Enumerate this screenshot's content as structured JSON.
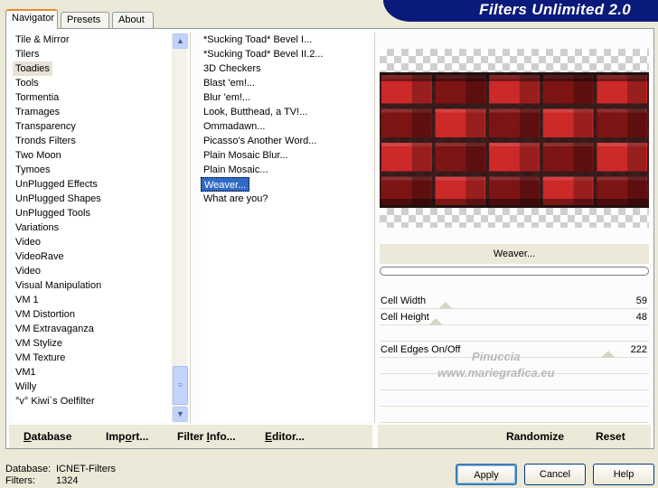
{
  "banner": {
    "title": "Filters Unlimited 2.0"
  },
  "tabs": [
    {
      "label": "Navigator",
      "active": true
    },
    {
      "label": "Presets",
      "active": false
    },
    {
      "label": "About",
      "active": false
    }
  ],
  "categories": [
    "Tile & Mirror",
    "Tilers",
    "Toadies",
    "Tools",
    "Tormentia",
    "Tramages",
    "Transparency",
    "Tronds Filters",
    "Two Moon",
    "Tymoes",
    "UnPlugged Effects",
    "UnPlugged Shapes",
    "UnPlugged Tools",
    "Variations",
    "Video",
    "VideoRave",
    "Video",
    "Visual Manipulation",
    "VM 1",
    "VM Distortion",
    "VM Extravaganza",
    "VM Stylize",
    "VM Texture",
    "VM1",
    "Willy",
    "°v° Kiwi`s Oelfilter"
  ],
  "selected_category": "Toadies",
  "filters": [
    "*Sucking Toad*  Bevel I...",
    "*Sucking Toad*  Bevel II.2...",
    "3D Checkers",
    "Blast 'em!...",
    "Blur 'em!...",
    "Look, Butthead, a TV!...",
    "Ommadawn...",
    "Picasso's Another Word...",
    "Plain Mosaic Blur...",
    "Plain Mosaic...",
    "Weaver...",
    "What are you?"
  ],
  "selected_filter": "Weaver...",
  "filter_name": "Weaver...",
  "progress": 0,
  "parameters": [
    {
      "label": "Cell Width",
      "value": "59",
      "level": 0.23
    },
    {
      "label": "Cell Height",
      "value": "48",
      "level": 0.19
    },
    {
      "label": "Cell Edges On/Off",
      "value": "222",
      "level": 0.87
    }
  ],
  "watermark": {
    "line1": "Pinuccia",
    "line2": "www.mariegrafica.eu"
  },
  "actions": {
    "database": {
      "u": "D",
      "rest": "atabase"
    },
    "import": {
      "pre": "Imp",
      "u": "o",
      "rest": "rt..."
    },
    "filter_info": {
      "pre": "Filter ",
      "u": "I",
      "rest": "nfo..."
    },
    "editor": {
      "u": "E",
      "rest": "ditor..."
    },
    "randomize": "Randomize",
    "reset": "Reset"
  },
  "status": {
    "database_label": "Database:",
    "database_value": "ICNET-Filters",
    "filters_label": "Filters:",
    "filters_value": "1324"
  },
  "buttons": {
    "apply": "Apply",
    "cancel": "Cancel",
    "help": "Help"
  },
  "colors": {
    "banner": "#0a1a7a",
    "selection": "#316ac5",
    "weave_red": "#d42a2a",
    "weave_dark": "#2a0a0a"
  }
}
